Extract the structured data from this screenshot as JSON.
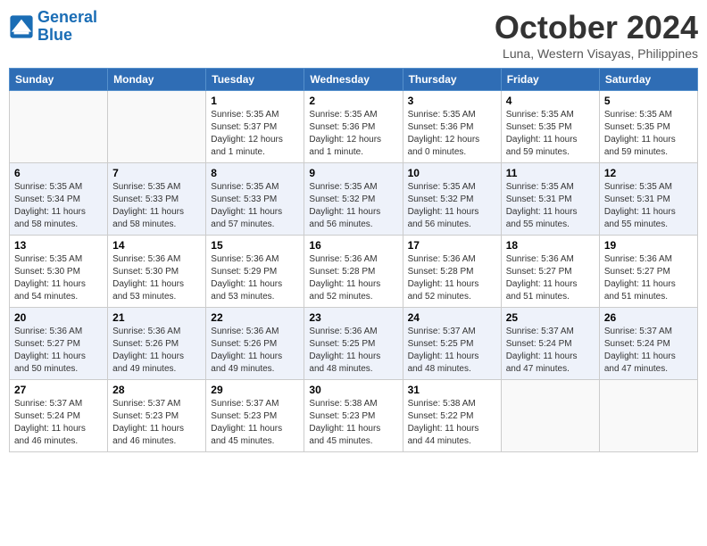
{
  "header": {
    "logo_line1": "General",
    "logo_line2": "Blue",
    "month": "October 2024",
    "location": "Luna, Western Visayas, Philippines"
  },
  "weekdays": [
    "Sunday",
    "Monday",
    "Tuesday",
    "Wednesday",
    "Thursday",
    "Friday",
    "Saturday"
  ],
  "weeks": [
    [
      {
        "day": "",
        "info": ""
      },
      {
        "day": "",
        "info": ""
      },
      {
        "day": "1",
        "info": "Sunrise: 5:35 AM\nSunset: 5:37 PM\nDaylight: 12 hours\nand 1 minute."
      },
      {
        "day": "2",
        "info": "Sunrise: 5:35 AM\nSunset: 5:36 PM\nDaylight: 12 hours\nand 1 minute."
      },
      {
        "day": "3",
        "info": "Sunrise: 5:35 AM\nSunset: 5:36 PM\nDaylight: 12 hours\nand 0 minutes."
      },
      {
        "day": "4",
        "info": "Sunrise: 5:35 AM\nSunset: 5:35 PM\nDaylight: 11 hours\nand 59 minutes."
      },
      {
        "day": "5",
        "info": "Sunrise: 5:35 AM\nSunset: 5:35 PM\nDaylight: 11 hours\nand 59 minutes."
      }
    ],
    [
      {
        "day": "6",
        "info": "Sunrise: 5:35 AM\nSunset: 5:34 PM\nDaylight: 11 hours\nand 58 minutes."
      },
      {
        "day": "7",
        "info": "Sunrise: 5:35 AM\nSunset: 5:33 PM\nDaylight: 11 hours\nand 58 minutes."
      },
      {
        "day": "8",
        "info": "Sunrise: 5:35 AM\nSunset: 5:33 PM\nDaylight: 11 hours\nand 57 minutes."
      },
      {
        "day": "9",
        "info": "Sunrise: 5:35 AM\nSunset: 5:32 PM\nDaylight: 11 hours\nand 56 minutes."
      },
      {
        "day": "10",
        "info": "Sunrise: 5:35 AM\nSunset: 5:32 PM\nDaylight: 11 hours\nand 56 minutes."
      },
      {
        "day": "11",
        "info": "Sunrise: 5:35 AM\nSunset: 5:31 PM\nDaylight: 11 hours\nand 55 minutes."
      },
      {
        "day": "12",
        "info": "Sunrise: 5:35 AM\nSunset: 5:31 PM\nDaylight: 11 hours\nand 55 minutes."
      }
    ],
    [
      {
        "day": "13",
        "info": "Sunrise: 5:35 AM\nSunset: 5:30 PM\nDaylight: 11 hours\nand 54 minutes."
      },
      {
        "day": "14",
        "info": "Sunrise: 5:36 AM\nSunset: 5:30 PM\nDaylight: 11 hours\nand 53 minutes."
      },
      {
        "day": "15",
        "info": "Sunrise: 5:36 AM\nSunset: 5:29 PM\nDaylight: 11 hours\nand 53 minutes."
      },
      {
        "day": "16",
        "info": "Sunrise: 5:36 AM\nSunset: 5:28 PM\nDaylight: 11 hours\nand 52 minutes."
      },
      {
        "day": "17",
        "info": "Sunrise: 5:36 AM\nSunset: 5:28 PM\nDaylight: 11 hours\nand 52 minutes."
      },
      {
        "day": "18",
        "info": "Sunrise: 5:36 AM\nSunset: 5:27 PM\nDaylight: 11 hours\nand 51 minutes."
      },
      {
        "day": "19",
        "info": "Sunrise: 5:36 AM\nSunset: 5:27 PM\nDaylight: 11 hours\nand 51 minutes."
      }
    ],
    [
      {
        "day": "20",
        "info": "Sunrise: 5:36 AM\nSunset: 5:27 PM\nDaylight: 11 hours\nand 50 minutes."
      },
      {
        "day": "21",
        "info": "Sunrise: 5:36 AM\nSunset: 5:26 PM\nDaylight: 11 hours\nand 49 minutes."
      },
      {
        "day": "22",
        "info": "Sunrise: 5:36 AM\nSunset: 5:26 PM\nDaylight: 11 hours\nand 49 minutes."
      },
      {
        "day": "23",
        "info": "Sunrise: 5:36 AM\nSunset: 5:25 PM\nDaylight: 11 hours\nand 48 minutes."
      },
      {
        "day": "24",
        "info": "Sunrise: 5:37 AM\nSunset: 5:25 PM\nDaylight: 11 hours\nand 48 minutes."
      },
      {
        "day": "25",
        "info": "Sunrise: 5:37 AM\nSunset: 5:24 PM\nDaylight: 11 hours\nand 47 minutes."
      },
      {
        "day": "26",
        "info": "Sunrise: 5:37 AM\nSunset: 5:24 PM\nDaylight: 11 hours\nand 47 minutes."
      }
    ],
    [
      {
        "day": "27",
        "info": "Sunrise: 5:37 AM\nSunset: 5:24 PM\nDaylight: 11 hours\nand 46 minutes."
      },
      {
        "day": "28",
        "info": "Sunrise: 5:37 AM\nSunset: 5:23 PM\nDaylight: 11 hours\nand 46 minutes."
      },
      {
        "day": "29",
        "info": "Sunrise: 5:37 AM\nSunset: 5:23 PM\nDaylight: 11 hours\nand 45 minutes."
      },
      {
        "day": "30",
        "info": "Sunrise: 5:38 AM\nSunset: 5:23 PM\nDaylight: 11 hours\nand 45 minutes."
      },
      {
        "day": "31",
        "info": "Sunrise: 5:38 AM\nSunset: 5:22 PM\nDaylight: 11 hours\nand 44 minutes."
      },
      {
        "day": "",
        "info": ""
      },
      {
        "day": "",
        "info": ""
      }
    ]
  ]
}
